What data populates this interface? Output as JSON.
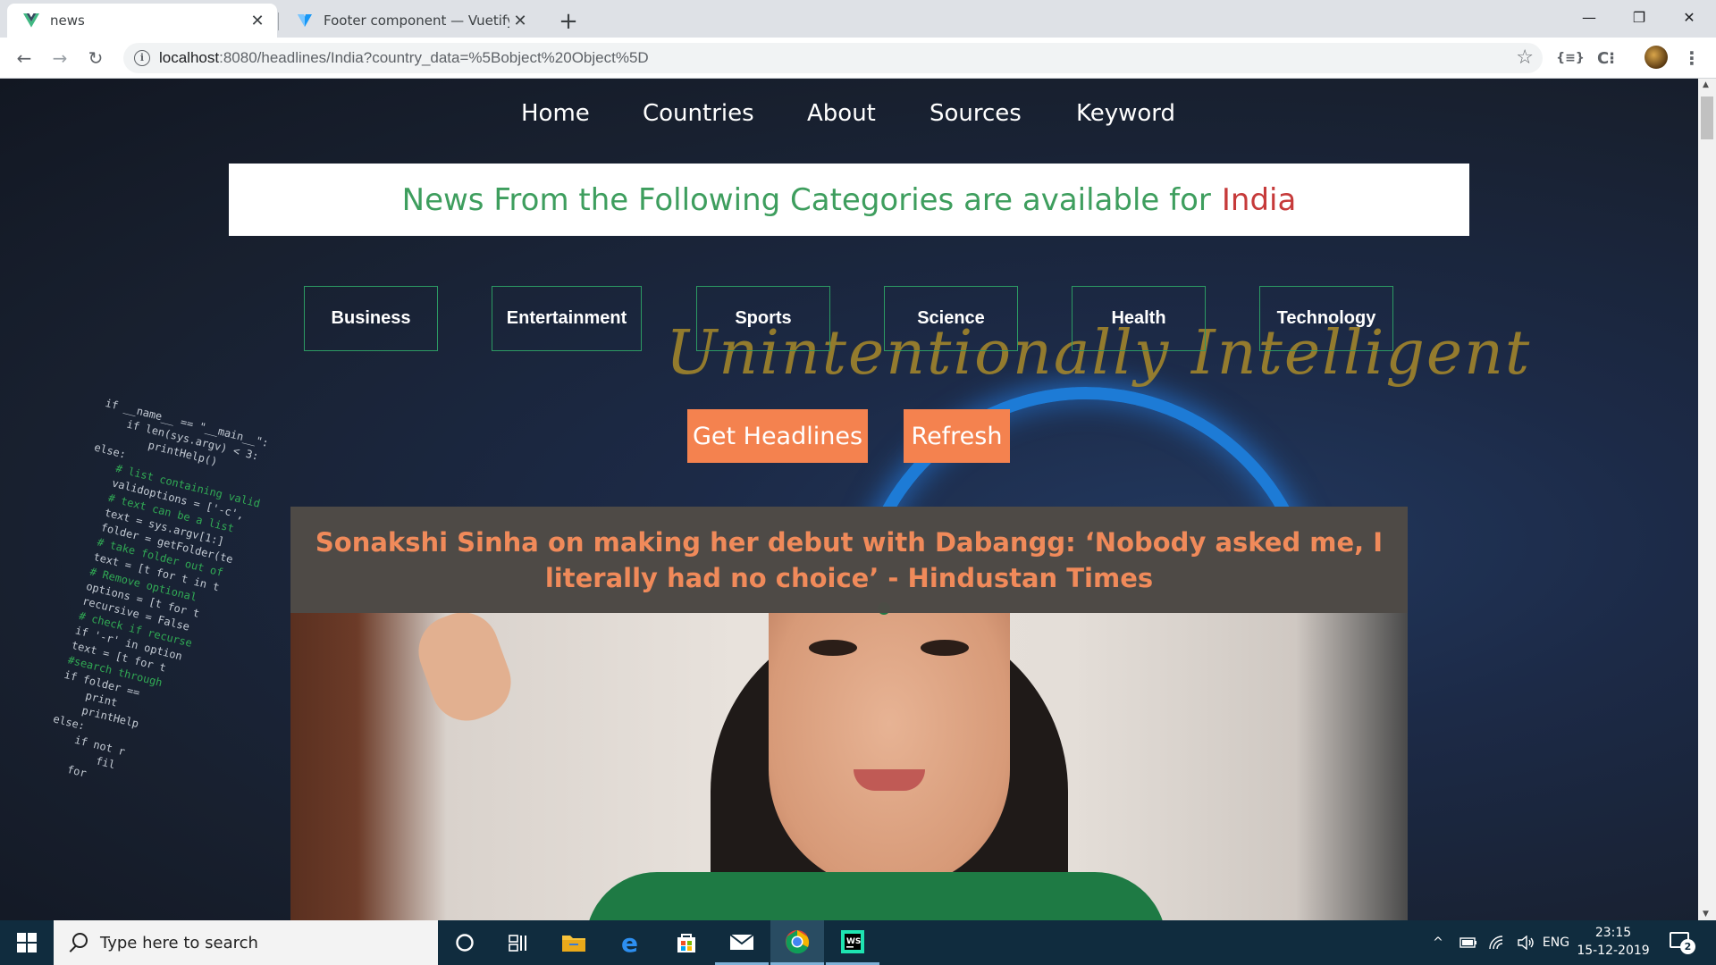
{
  "browser": {
    "tabs": [
      {
        "title": "news",
        "active": true
      },
      {
        "title": "Footer component — Vuetify.js",
        "active": false
      }
    ],
    "close_glyph": "✕",
    "new_tab_glyph": "+",
    "url": {
      "host": "localhost",
      "rest": ":8080/headlines/India?country_data=%5Bobject%20Object%5D"
    },
    "icons": {
      "back": "arrow-left-icon",
      "forward": "arrow-right-icon",
      "reload": "reload-icon",
      "info": "info-icon",
      "star": "star-icon"
    },
    "glyphs": {
      "back": "←",
      "forward": "→",
      "reload": "↻",
      "info": "i",
      "star": "☆",
      "minimize": "—",
      "maximize": "❐",
      "close": "✕"
    },
    "extensions": [
      "{≡}",
      "C⁝"
    ],
    "menu_glyph": "⋮"
  },
  "nav": {
    "items": [
      "Home",
      "Countries",
      "About",
      "Sources",
      "Keyword"
    ]
  },
  "banner": {
    "text": "News From the Following Categories are available for",
    "country": "India",
    "text_color": "#3e9e5e",
    "country_color": "#c63a3a"
  },
  "brand_text": "Unintentionally Intelligent",
  "categories": [
    "Business",
    "Entertainment",
    "Sports",
    "Science",
    "Health",
    "Technology"
  ],
  "actions": {
    "get_headlines": "Get Headlines",
    "refresh": "Refresh",
    "color": "#f4824f"
  },
  "article": {
    "headline": "Sonakshi Sinha on making her debut with Dabangg: ‘Nobody asked me, I literally had no choice’ - Hindustan Times",
    "headline_color": "#f08a5a"
  },
  "taskbar": {
    "search_placeholder": "Type here to search",
    "tray_language": "ENG",
    "time": "23:15",
    "date": "15-12-2019",
    "notification_count": "2",
    "tray_chevron": "^"
  }
}
